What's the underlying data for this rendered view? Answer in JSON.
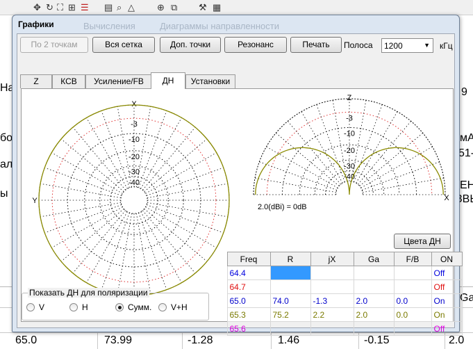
{
  "dialog": {
    "title": "Графики",
    "ghost_left": "Вычисления",
    "ghost_right": "Диаграммы направленности"
  },
  "toolbar": {
    "two_points": "По 2 точкам",
    "full_grid": "Вся сетка",
    "extra_points": "Доп. точки",
    "resonance": "Резонанс",
    "print": "Печать",
    "band_label": "Полоса",
    "band_value": "1200",
    "band_unit": "кГц"
  },
  "tabs": [
    "Z",
    "КСВ",
    "Усиление/FB",
    "ДН",
    "Установки"
  ],
  "active_tab": 3,
  "polar_left": {
    "axis_top": "X",
    "axis_left": "Y",
    "rings": [
      "-3",
      "-10",
      "-20",
      "-30",
      "-40"
    ]
  },
  "polar_right": {
    "axis_top": "Z",
    "axis_right": "X",
    "rings": [
      "-3",
      "-10",
      "-20",
      "-30",
      "-40"
    ]
  },
  "gain_note": "2.0(dBi) = 0dB",
  "colors_button": "Цвета ДН",
  "table": {
    "headers": [
      "Freq",
      "R",
      "jX",
      "Ga",
      "F/B",
      "ON"
    ],
    "rows": [
      {
        "freq": "64.4",
        "r": "",
        "jx": "",
        "ga": "",
        "fb": "",
        "on": "Off",
        "color": "#0000dd"
      },
      {
        "freq": "64.7",
        "r": "",
        "jx": "",
        "ga": "",
        "fb": "",
        "on": "Off",
        "color": "#e01010"
      },
      {
        "freq": "65.0",
        "r": "74.0",
        "jx": "-1.3",
        "ga": "2.0",
        "fb": "0.0",
        "on": "On",
        "color": "#0000cc"
      },
      {
        "freq": "65.3",
        "r": "75.2",
        "jx": "2.2",
        "ga": "2.0",
        "fb": "0.0",
        "on": "On",
        "color": "#7a7a00"
      },
      {
        "freq": "65.6",
        "r": "",
        "jx": "",
        "ga": "",
        "fb": "",
        "on": "Off",
        "color": "#e000e0"
      }
    ]
  },
  "polarization": {
    "legend": "Показать ДН для поляризации",
    "options": [
      "V",
      "H",
      "Сумм.",
      "V+H"
    ],
    "selected": 2
  },
  "background": {
    "edge_left": [
      "На",
      "бо",
      "ал",
      "ы"
    ],
    "edge_right": [
      "9",
      "мА",
      "51-",
      "ЕН",
      "ЗВЬ"
    ],
    "bottom_values": [
      "65.0",
      "73.99",
      "-1.28",
      "1.46",
      "-0.15",
      "2.0"
    ],
    "ga_header": "Ga"
  },
  "colors": {
    "pattern": "#8a8a00",
    "grid_red": "#e03030",
    "grid_black": "#000000"
  }
}
